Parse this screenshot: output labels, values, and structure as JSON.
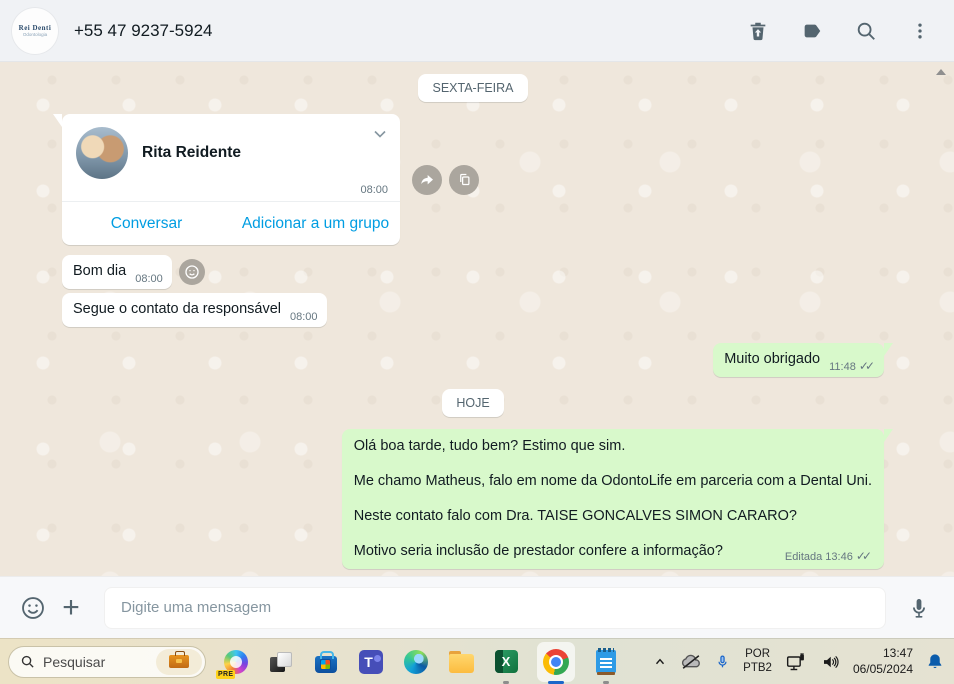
{
  "header": {
    "phone": "+55 47 9237-5924",
    "avatar": {
      "name": "Rei Denti",
      "sub": "Odontologia"
    }
  },
  "chat": {
    "divider_friday": "SEXTA-FEIRA",
    "divider_today": "HOJE",
    "contact_card": {
      "name": "Rita Reidente",
      "time": "08:00",
      "action_chat": "Conversar",
      "action_add": "Adicionar a um grupo"
    },
    "msg_bom_dia": {
      "text": "Bom dia",
      "time": "08:00"
    },
    "msg_contato": {
      "text": "Segue o contato da responsável",
      "time": "08:00"
    },
    "msg_obrigado": {
      "text": "Muito obrigado",
      "time": "11:48",
      "checks": "✓✓"
    },
    "msg_long": {
      "line1": "Olá boa tarde, tudo bem? Estimo que sim.",
      "line2": "Me chamo Matheus, falo em nome da OdontoLife em parceria com a Dental Uni.",
      "line3": "Neste contato falo com Dra. TAISE GONCALVES SIMON CARARO?",
      "line4": "Motivo seria inclusão de prestador confere a informação?",
      "meta_edited": "Editada",
      "time": "13:46",
      "checks": "✓✓"
    }
  },
  "composer": {
    "placeholder": "Digite uma mensagem"
  },
  "taskbar": {
    "search_placeholder": "Pesquisar",
    "copilot_badge": "PRE",
    "teams_letter": "T",
    "excel_letter": "X",
    "tray": {
      "lang1": "POR",
      "lang2": "PTB2",
      "clock_time": "13:47",
      "clock_date": "06/05/2024"
    }
  },
  "colors": {
    "header_bg": "#f0f2f5",
    "chat_bg": "#efe7dc",
    "sent_bubble": "#d8f9cb",
    "link_blue": "#009de2",
    "icon_gray": "#54656f",
    "meta_gray": "#667781",
    "windows_accent": "#1b66c9"
  }
}
